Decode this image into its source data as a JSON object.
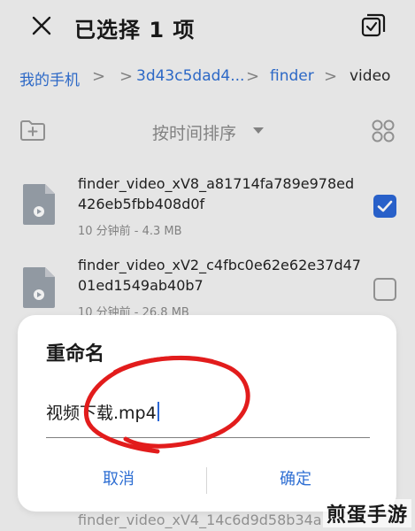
{
  "topbar": {
    "close_icon": "close-icon",
    "title": "已选择 1 项",
    "select_all_icon": "select-all-icon"
  },
  "breadcrumb": {
    "items": [
      "我的手机",
      "3d43c5dad4...",
      "finder",
      "video"
    ],
    "separator": ">"
  },
  "toolbar": {
    "new_folder_icon": "new-folder-icon",
    "sort_label": "按时间排序",
    "grid_icon": "grid-view-icon"
  },
  "files": [
    {
      "name": "finder_video_xV8_a81714fa789e978ed426eb5fbb408d0f",
      "meta": "10 分钟前 - 4.3 MB",
      "checked": true
    },
    {
      "name": "finder_video_xV2_c4fbc0e62e62e37d4701ed1549ab40b7",
      "meta": "10 分钟前 - 26.8 MB",
      "checked": false
    }
  ],
  "dialog": {
    "title": "重命名",
    "input_value": "视频下载.mp4",
    "cancel_label": "取消",
    "ok_label": "确定"
  },
  "bottom_file": {
    "name": "finder_video_xV4_14c6d9d58b34a"
  },
  "watermark": "煎蛋手游",
  "colors": {
    "accent": "#2f6fd3",
    "checkbox_on": "#2b67d6",
    "scribble": "#e21c1c"
  }
}
